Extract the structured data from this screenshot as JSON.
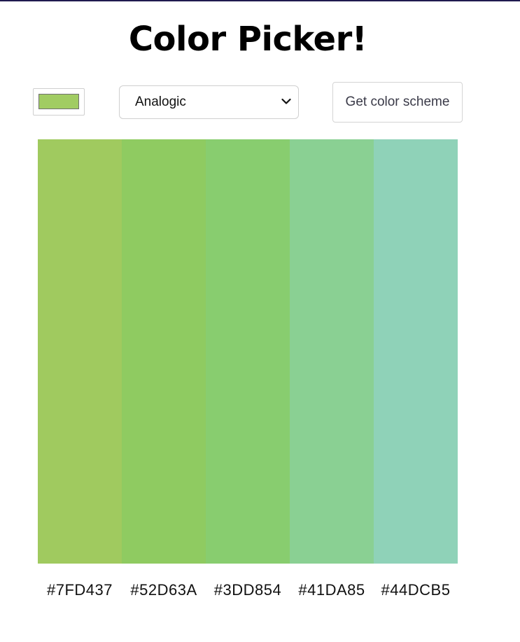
{
  "header": {
    "title": "Color Picker!"
  },
  "controls": {
    "seed_color": "#a1cc63",
    "mode_selected": "Analogic",
    "mode_icon": "chevron-down-icon",
    "button_label": "Get color scheme"
  },
  "palette": {
    "colors": [
      {
        "hex_label": "#7FD437",
        "display_color": "#a0ca5f"
      },
      {
        "hex_label": "#52D63A",
        "display_color": "#8fcb61"
      },
      {
        "hex_label": "#3DD854",
        "display_color": "#88cd6f"
      },
      {
        "hex_label": "#41DA85",
        "display_color": "#8ad093"
      },
      {
        "hex_label": "#44DCB5",
        "display_color": "#8fd2b8"
      }
    ]
  },
  "colors": {
    "top_border": "#1f1a4f",
    "title_text": "#000000",
    "button_text": "#3a3a48"
  }
}
